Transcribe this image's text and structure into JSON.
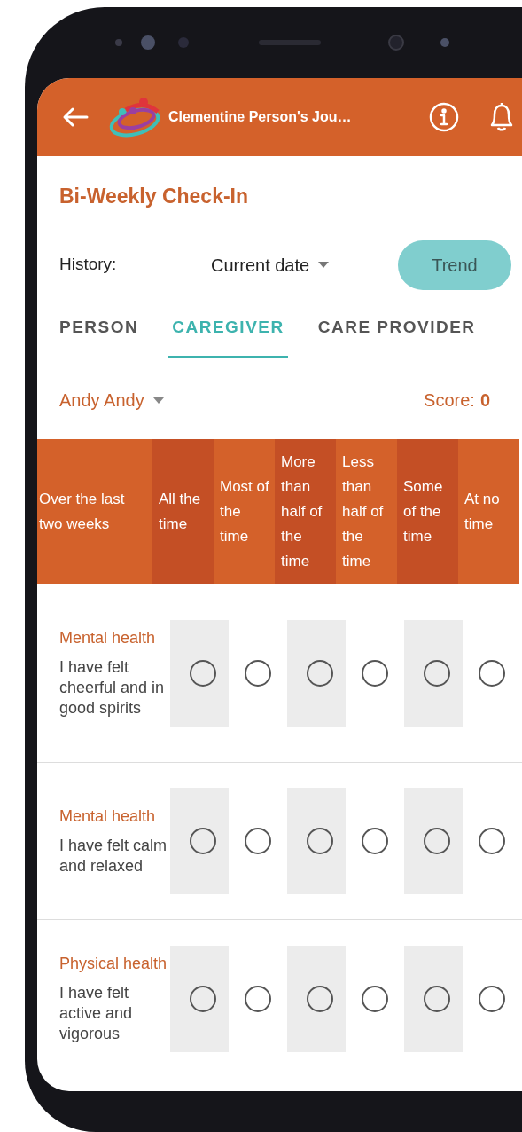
{
  "header": {
    "title": "Clementine Person's Jou…"
  },
  "page_title": "Bi-Weekly Check-In",
  "history": {
    "label": "History:",
    "value": "Current date",
    "button": "Trend"
  },
  "tabs": [
    {
      "label": "PERSON",
      "selected": false
    },
    {
      "label": "CAREGIVER",
      "selected": true
    },
    {
      "label": "CARE PROVIDER",
      "selected": false
    }
  ],
  "person": {
    "name": "Andy Andy",
    "score_label": "Score:",
    "score": "0"
  },
  "table": {
    "columns": [
      "Over the last two weeks",
      "All the time",
      "Most of the time",
      "More than half of the time",
      "Less than half of the time",
      "Some of the time",
      "At no time"
    ],
    "rows": [
      {
        "category": "Mental health",
        "question": "I have felt cheerful and in good spirits",
        "answers": [
          {
            "selected": false
          },
          {
            "selected": false
          },
          {
            "selected": false
          },
          {
            "selected": false
          },
          {
            "selected": false
          },
          {
            "selected": false
          }
        ]
      },
      {
        "category": "Mental health",
        "question": "I have felt calm and relaxed",
        "answers": [
          {
            "selected": false
          },
          {
            "selected": false
          },
          {
            "selected": false
          },
          {
            "selected": false
          },
          {
            "selected": false
          },
          {
            "selected": false
          }
        ]
      },
      {
        "category": "Physical health",
        "question": "I have felt active and vigorous",
        "answers": [
          {
            "selected": false
          },
          {
            "selected": false
          },
          {
            "selected": false
          },
          {
            "selected": false
          },
          {
            "selected": false
          },
          {
            "selected": false
          }
        ]
      }
    ]
  }
}
